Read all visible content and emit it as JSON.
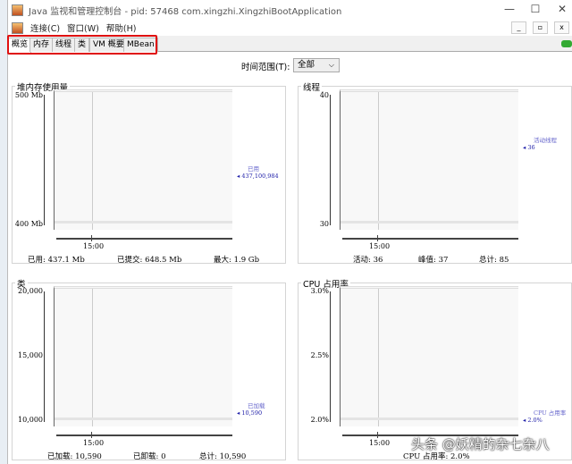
{
  "window": {
    "title": "Java 监视和管理控制台 - pid: 57468 com.xingzhi.XingzhiBootApplication",
    "minimize": "—",
    "maximize": "☐",
    "close": "✕"
  },
  "menu": [
    "连接(C)",
    "窗口(W)",
    "帮助(H)"
  ],
  "tabs": [
    "概览",
    "内存",
    "线程",
    "类",
    "VM 概要",
    "MBean"
  ],
  "time_range": {
    "label": "时间范围(T):",
    "value": "全部"
  },
  "panels": {
    "heap": {
      "title": "堆内存使用量",
      "y_top": "500 Mb",
      "y_bottom": "400 Mb",
      "x_tick": "15:00",
      "legend_name": "已用",
      "legend_value": "437,100,984",
      "stats": [
        {
          "label": "已用:",
          "value": "437.1 Mb"
        },
        {
          "label": "已提交:",
          "value": "648.5 Mb"
        },
        {
          "label": "最大:",
          "value": "1.9 Gb"
        }
      ]
    },
    "threads": {
      "title": "线程",
      "y_top": "40",
      "y_bottom": "30",
      "x_tick": "15:00",
      "legend_name": "活动线程",
      "legend_value": "36",
      "stats": [
        {
          "label": "活动:",
          "value": "36"
        },
        {
          "label": "峰值:",
          "value": "37"
        },
        {
          "label": "总计:",
          "value": "85"
        }
      ]
    },
    "classes": {
      "title": "类",
      "y_top": "20,000",
      "y_mid": "15,000",
      "y_bottom": "10,000",
      "x_tick": "15:00",
      "legend_name": "已加载",
      "legend_value": "10,590",
      "stats": [
        {
          "label": "已加载:",
          "value": "10,590"
        },
        {
          "label": "已卸载:",
          "value": "0"
        },
        {
          "label": "总计:",
          "value": "10,590"
        }
      ]
    },
    "cpu": {
      "title": "CPU 占用率",
      "y_top": "3.0%",
      "y_mid": "2.5%",
      "y_bottom": "2.0%",
      "x_tick": "15:00",
      "legend_name": "CPU 占用率",
      "legend_value": "2.0%",
      "stats": [
        {
          "label": "CPU 占用率:",
          "value": "2.0%"
        }
      ]
    }
  },
  "watermark": "头条 @妖精的杂七杂八"
}
